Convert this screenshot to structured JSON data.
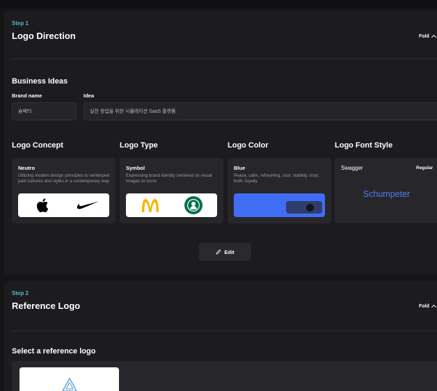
{
  "step1": {
    "step_label": "Step 1",
    "title": "Logo Direction",
    "fold_label": "Fold",
    "business": {
      "title": "Business Ideas",
      "brand_label": "Brand name",
      "brand_value": "슘페터",
      "idea_label": "Idea",
      "idea_value": "실전 창업을 위한 시뮬레이션 SaaS 플랫폼"
    },
    "concept": {
      "title": "Logo Concept",
      "name": "Neutro",
      "desc": "Utilizing modern design principles to reinterpret past cultures and styles in a contemporary way",
      "logos": [
        "apple-logo",
        "nike-logo"
      ]
    },
    "type": {
      "title": "Logo Type",
      "name": "Symbol",
      "desc": "Expressing brand identity centered on visual images or icons",
      "logos": [
        "mcdonalds-logo",
        "starbucks-logo"
      ]
    },
    "color": {
      "title": "Logo Color",
      "name": "Blue",
      "desc": "Peace, calm, refreshing, cool, stability, trust, truth, loyalty",
      "swatch": "#3f6ef5"
    },
    "font": {
      "title": "Logo Font Style",
      "name": "Swagger",
      "weight": "Regular",
      "sample": "Schumpeter",
      "sample_color": "#4f7cf0"
    },
    "edit_label": "Edit"
  },
  "step2": {
    "step_label": "Step 2",
    "title": "Reference Logo",
    "fold_label": "Fold",
    "select_title": "Select a reference logo"
  },
  "colors": {
    "accent_teal": "#56b5c6",
    "background": "#151518",
    "panel": "#1c1c1f",
    "card": "#27272b"
  }
}
